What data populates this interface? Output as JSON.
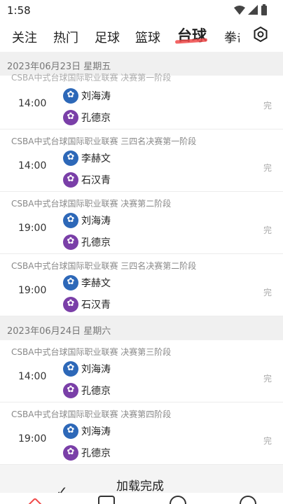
{
  "status_bar": {
    "time": "1:58"
  },
  "tabs": [
    {
      "label": "关注"
    },
    {
      "label": "热门"
    },
    {
      "label": "足球"
    },
    {
      "label": "篮球"
    },
    {
      "label": "台球",
      "active": true
    },
    {
      "label": "拳击"
    }
  ],
  "accent_color": "#f04a4a",
  "dates": [
    {
      "label": "2023年06月23日  星期五",
      "matches": [
        {
          "league": "CSBA中式台球国际职业联赛 决赛第一阶段",
          "time": "14:00",
          "p1": "刘海涛",
          "p2": "孔德京",
          "status": "完"
        },
        {
          "league": "CSBA中式台球国际职业联赛 三四名决赛第一阶段",
          "time": "14:00",
          "p1": "李赫文",
          "p2": "石汉青",
          "status": "完"
        },
        {
          "league": "CSBA中式台球国际职业联赛 决赛第二阶段",
          "time": "19:00",
          "p1": "刘海涛",
          "p2": "孔德京",
          "status": "完"
        },
        {
          "league": "CSBA中式台球国际职业联赛 三四名决赛第二阶段",
          "time": "19:00",
          "p1": "李赫文",
          "p2": "石汉青",
          "status": "完"
        }
      ]
    },
    {
      "label": "2023年06月24日  星期六",
      "matches": [
        {
          "league": "CSBA中式台球国际职业联赛 决赛第三阶段",
          "time": "14:00",
          "p1": "刘海涛",
          "p2": "孔德京",
          "status": "完"
        },
        {
          "league": "CSBA中式台球国际职业联赛 决赛第四阶段",
          "time": "19:00",
          "p1": "刘海涛",
          "p2": "孔德京",
          "status": "完"
        }
      ]
    }
  ],
  "load": {
    "text": "加载完成"
  }
}
